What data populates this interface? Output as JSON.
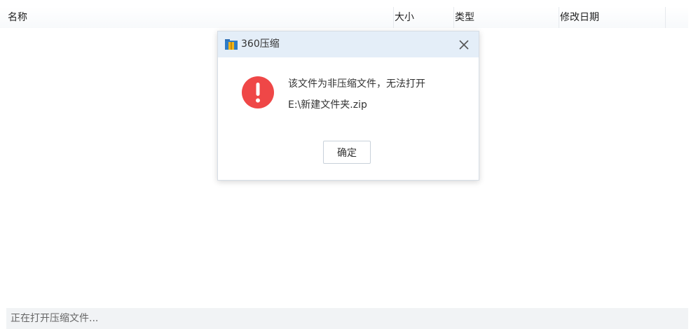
{
  "list_header": {
    "columns": [
      "名称",
      "大小",
      "类型",
      "修改日期"
    ]
  },
  "dialog": {
    "title": "360压缩",
    "app_icon": "archive-folder-icon",
    "close_icon": "close-icon",
    "error_icon": "exclamation-circle-icon",
    "error_color": "#ef4747",
    "message": "该文件为非压缩文件，无法打开",
    "file_path": "E:\\新建文件夹.zip",
    "ok_label": "确定"
  },
  "status": {
    "text": "正在打开压缩文件..."
  },
  "colors": {
    "titlebar_bg": "#e4eef8",
    "statusbar_bg": "#f1f3f5"
  }
}
